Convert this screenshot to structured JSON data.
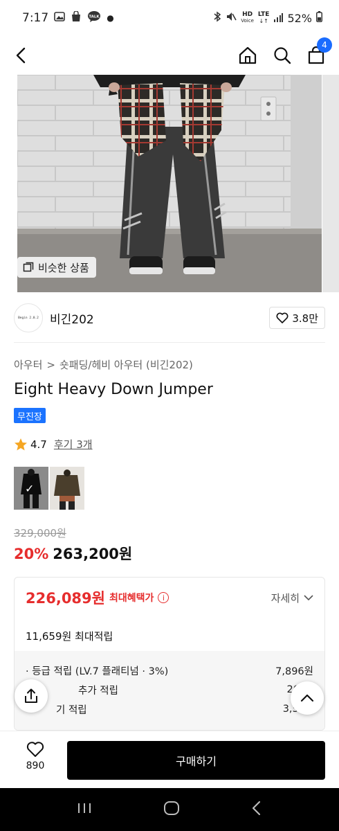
{
  "status": {
    "time": "7:17",
    "talk": "TALK",
    "hd": "HD",
    "voice": "Voice",
    "lte": "LTE",
    "battery": "52%"
  },
  "nav": {
    "cart_count": "4"
  },
  "hero": {
    "similar_label": "비슷한 상품"
  },
  "brand": {
    "logo_text": "Begin 2.0.2",
    "name": "비긴202",
    "likes": "3.8만"
  },
  "breadcrumb": {
    "category": "아우터",
    "separator": ">",
    "subcategory": "숏패딩/헤비 아우터 (비긴202)"
  },
  "product": {
    "title": "Eight Heavy Down Jumper",
    "tag": "무진장",
    "rating": "4.7",
    "reviews": "후기 3개"
  },
  "price": {
    "original": "329,000원",
    "discount": "20%",
    "sale": "263,200원"
  },
  "benefit": {
    "max_price": "226,089원",
    "max_label": "최대혜택가",
    "detail": "자세히",
    "points_total": "11,659원 최대적립",
    "rows": [
      {
        "label": "· 등급 적립 (LV.7 플래티넘 · 3%)",
        "value": "7,896원"
      },
      {
        "label": "추가 적립",
        "value": "20"
      },
      {
        "label": "기 적립",
        "value": "3,50"
      }
    ]
  },
  "bottom": {
    "wish_count": "890",
    "buy_label": "구매하기"
  },
  "colors": {
    "accent_red": "#e62d2d",
    "brand_blue": "#1b73ff",
    "cart_badge": "#1a6cff",
    "star": "#f5a623"
  }
}
